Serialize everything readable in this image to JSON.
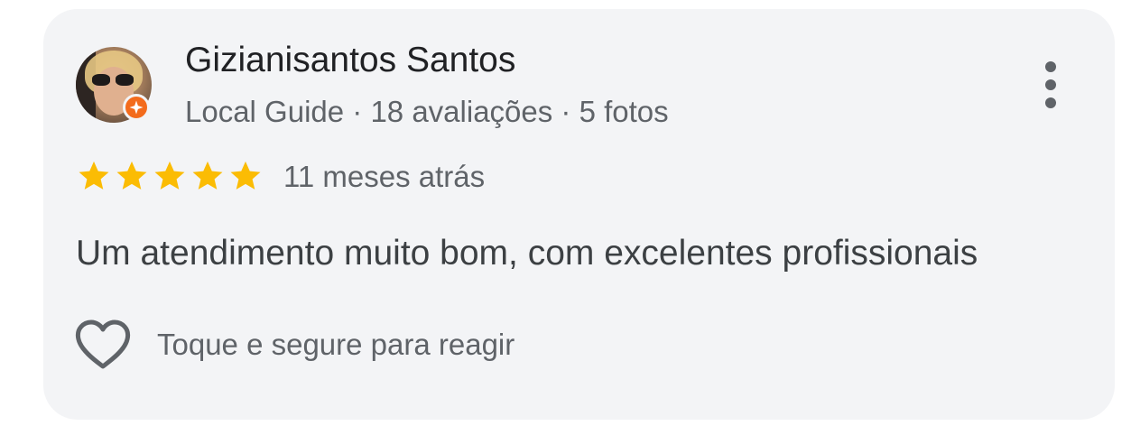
{
  "review": {
    "author_name": "Gizianisantos Santos",
    "author_meta": "Local Guide · 18 avaliações · 5 fotos",
    "rating": 5,
    "rating_max": 5,
    "time_ago": "11 meses atrás",
    "text": "Um atendimento muito bom, com excelentes profissionais",
    "react_hint": "Toque e segure para reagir"
  },
  "icons": {
    "badge": "local-guide-badge-icon",
    "more": "more-vertical-icon",
    "star": "star-icon",
    "heart": "heart-outline-icon"
  },
  "colors": {
    "card_bg": "#f3f4f6",
    "star": "#fbbc04",
    "badge": "#f36b1c",
    "text_primary": "#202124",
    "text_secondary": "#5f6368"
  }
}
